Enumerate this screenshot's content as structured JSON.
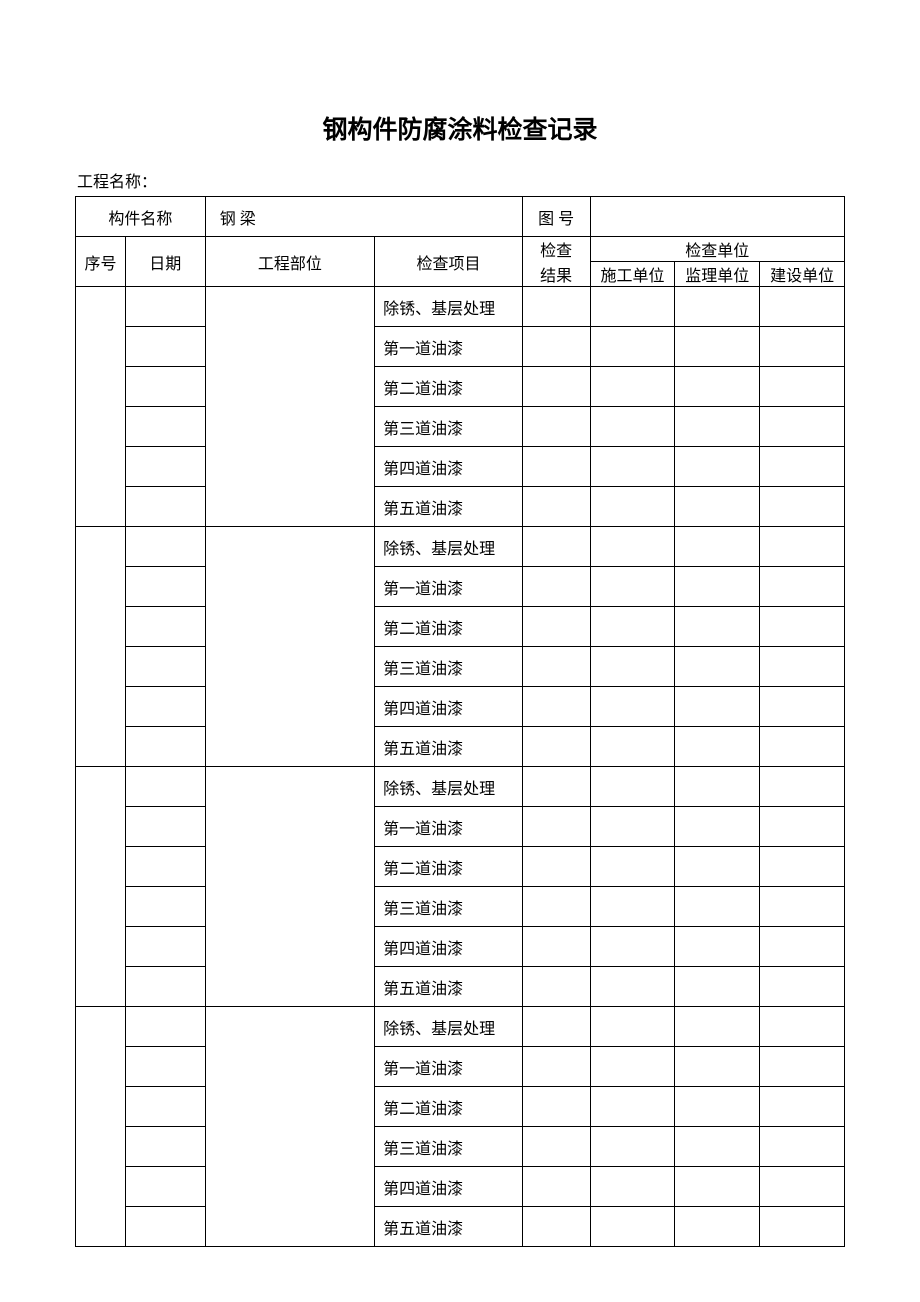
{
  "title": "钢构件防腐涂料检查记录",
  "projectNameLabel": "工程名称：",
  "header": {
    "componentName": "构件名称",
    "componentValue": "钢 梁",
    "drawingNo": "图 号",
    "seq": "序号",
    "date": "日期",
    "part": "工程部位",
    "item": "检查项目",
    "result": "检查\n结果",
    "resultLine1": "检查",
    "resultLine2": "结果",
    "checkUnit": "检查单位",
    "constructionUnit": "施工单位",
    "supervisionUnit": "监理单位",
    "ownerUnit": "建设单位"
  },
  "itemSets": [
    [
      "除锈、基层处理",
      "第一道油漆",
      "第二道油漆",
      "第三道油漆",
      "第四道油漆",
      "第五道油漆"
    ],
    [
      "除锈、基层处理",
      "第一道油漆",
      "第二道油漆",
      "第三道油漆",
      "第四道油漆",
      "第五道油漆"
    ],
    [
      "除锈、基层处理",
      "第一道油漆",
      "第二道油漆",
      "第三道油漆",
      "第四道油漆",
      "第五道油漆"
    ],
    [
      "除锈、基层处理",
      "第一道油漆",
      "第二道油漆",
      "第三道油漆",
      "第四道油漆",
      "第五道油漆"
    ]
  ]
}
